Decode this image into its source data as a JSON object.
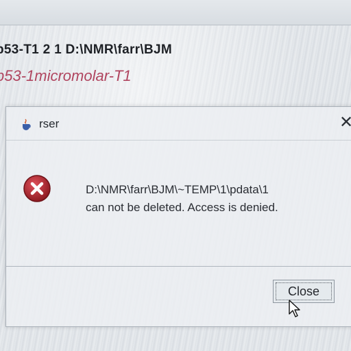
{
  "background": {
    "title_line": "p53-T1  2  1  D:\\NMR\\farr\\BJM",
    "subtitle_line": "p53-1micromolar-T1"
  },
  "dialog": {
    "title": "rser",
    "message_lines": [
      "D:\\NMR\\farr\\BJM\\~TEMP\\1\\pdata\\1",
      "can not be deleted. Access is denied."
    ],
    "close_x": "✕",
    "close_button_label": "Close",
    "app_icon": "java-cup-icon",
    "error_icon": "error-icon",
    "error_color": "#b3262e",
    "cursor_icon": "mouse-pointer-icon"
  }
}
